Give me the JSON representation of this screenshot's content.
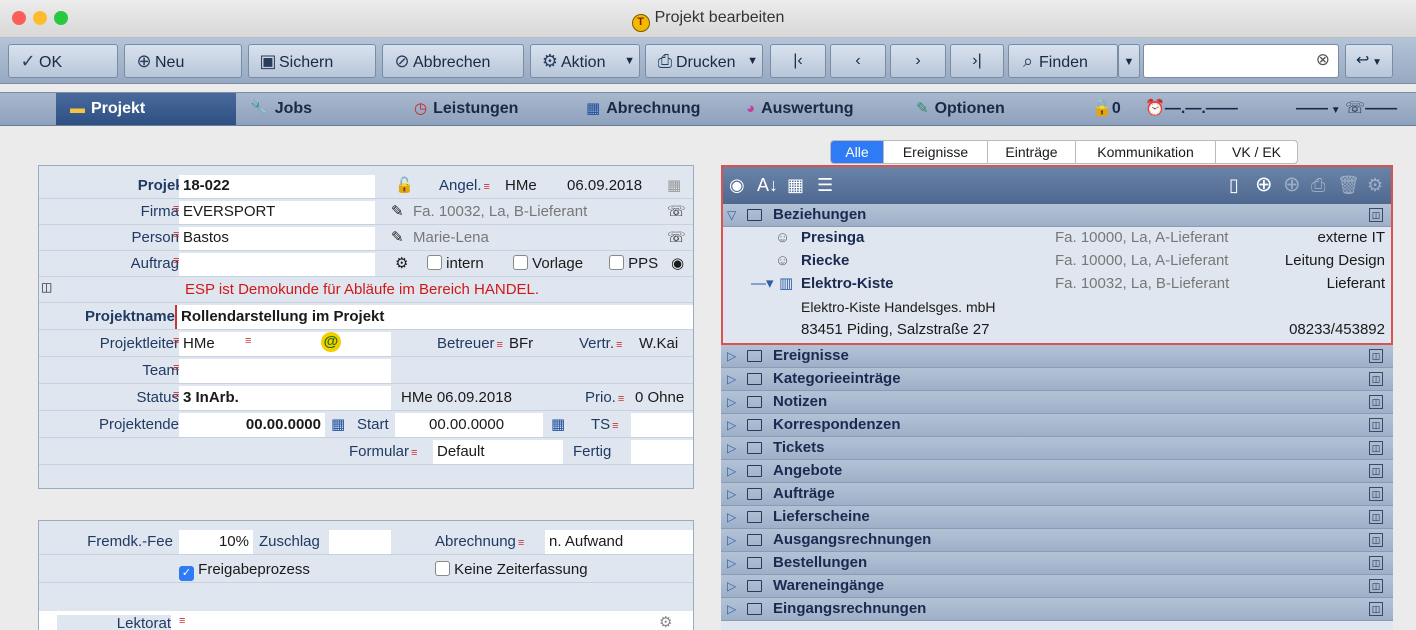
{
  "window": {
    "title": "Projekt bearbeiten",
    "title_icon": "T",
    "traffic": [
      "#fc5f57",
      "#fdbc2e",
      "#28c840"
    ]
  },
  "toolbar": {
    "buttons": [
      {
        "icon": "✓",
        "label": "OK"
      },
      {
        "icon": "⊕",
        "label": "Neu"
      },
      {
        "icon": "▣",
        "label": "Sichern"
      },
      {
        "icon": "⊘",
        "label": "Abbrechen"
      },
      {
        "icon": "⚙",
        "label": "Aktion"
      },
      {
        "icon": "⎙",
        "label": "Drucken"
      },
      {
        "icon": "|‹",
        "label": ""
      },
      {
        "icon": "‹",
        "label": ""
      },
      {
        "icon": "›",
        "label": ""
      },
      {
        "icon": "›|",
        "label": ""
      },
      {
        "icon": "⌕",
        "label": "Finden"
      }
    ],
    "search_clear": "⊗",
    "back_icon": "↩"
  },
  "tabs": [
    {
      "label": "Projekt",
      "icon": "▬"
    },
    {
      "label": "Jobs",
      "icon": "🔧"
    },
    {
      "label": "Leistungen",
      "icon": "◷"
    },
    {
      "label": "Abrechnung",
      "icon": "▦"
    },
    {
      "label": "Auswertung",
      "icon": "◕"
    },
    {
      "label": "Optionen",
      "icon": "✎"
    }
  ],
  "status": {
    "lock_count": "0",
    "time": "—.—.——",
    "dash": "——"
  },
  "form": {
    "projektnr_label": "Projektnr.",
    "projektnr": "18-022",
    "angel_label": "Angel.",
    "angel": "HMe",
    "angel_date": "06.09.2018",
    "firma_label": "Firma",
    "firma": "EVERSPORT",
    "firma_info": "Fa. 10032, La, B-Lieferant",
    "person_label": "Person",
    "person": "Bastos",
    "person_info": "Marie-Lena",
    "auftrag_label": "Auftrag",
    "intern": "intern",
    "vorlage": "Vorlage",
    "pps": "PPS",
    "notice": "ESP ist Demokunde für Abläufe im Bereich HANDEL.",
    "projektname_label": "Projektname",
    "projektname": "Rollendarstellung im Projekt",
    "projektleiter_label": "Projektleiter",
    "projektleiter": "HMe",
    "betreuer_label": "Betreuer",
    "betreuer": "BFr",
    "vertr_label": "Vertr.",
    "vertr": "W.Kai",
    "team_label": "Team",
    "status_label": "Status",
    "status": "3 InArb.",
    "status_by": "HMe 06.09.2018",
    "prio_label": "Prio.",
    "prio": "0 Ohne",
    "projektende_label": "Projektende",
    "projektende": "00.00.0000",
    "start_label": "Start",
    "start": "00.00.0000",
    "ts_label": "TS",
    "formular_label": "Formular",
    "formular": "Default",
    "fertig": "Fertig"
  },
  "form2": {
    "fee_label": "Fremdk.-Fee",
    "fee": "10%",
    "zuschlag": "Zuschlag",
    "abrechnung_label": "Abrechnung",
    "abrechnung": "n. Aufwand",
    "freigabe": "Freigabeprozess",
    "keine": "Keine Zeiterfassung",
    "lektorat_label": "Lektorat"
  },
  "right_tabs": [
    "Alle",
    "Ereignisse",
    "Einträge",
    "Kommunikation",
    "VK / EK"
  ],
  "tree": {
    "beziehungen": "Beziehungen",
    "relations": [
      {
        "name": "Presinga",
        "info": "Fa. 10000, La, A-Lieferant",
        "role": "externe IT"
      },
      {
        "name": "Riecke",
        "info": "Fa. 10000, La, A-Lieferant",
        "role": "Leitung Design"
      },
      {
        "name": "Elektro-Kiste",
        "info": "Fa. 10032, La, B-Lieferant",
        "role": "Lieferant"
      }
    ],
    "company_full": "Elektro-Kiste Handelsges. mbH",
    "company_addr": "83451 Piding, Salzstraße 27",
    "company_phone": "08233/453892",
    "categories": [
      "Ereignisse",
      "Kategorieeinträge",
      "Notizen",
      "Korrespondenzen",
      "Tickets",
      "Angebote",
      "Aufträge",
      "Lieferscheine",
      "Ausgangsrechnungen",
      "Bestellungen",
      "Wareneingänge",
      "Eingangsrechnungen"
    ]
  }
}
